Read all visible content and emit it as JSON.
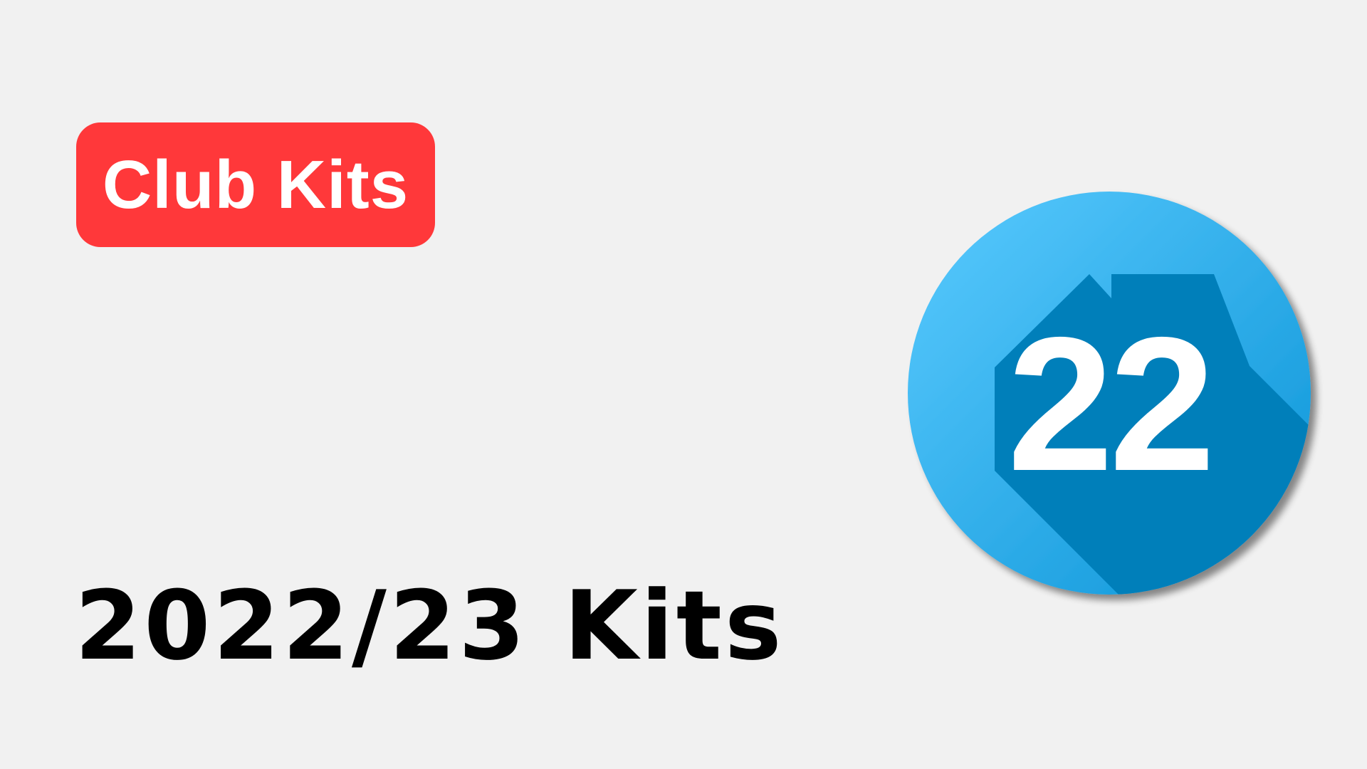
{
  "badge": {
    "label": "Club Kits",
    "color": "#ff383a"
  },
  "headline": {
    "text": "2022/23 Kits"
  },
  "season_icon": {
    "name": "season-22-icon",
    "number": "22",
    "colors": {
      "circle_light": "#5bcbff",
      "circle_dark": "#0a93d6",
      "long_shadow": "#007fba",
      "number": "#ffffff"
    }
  }
}
